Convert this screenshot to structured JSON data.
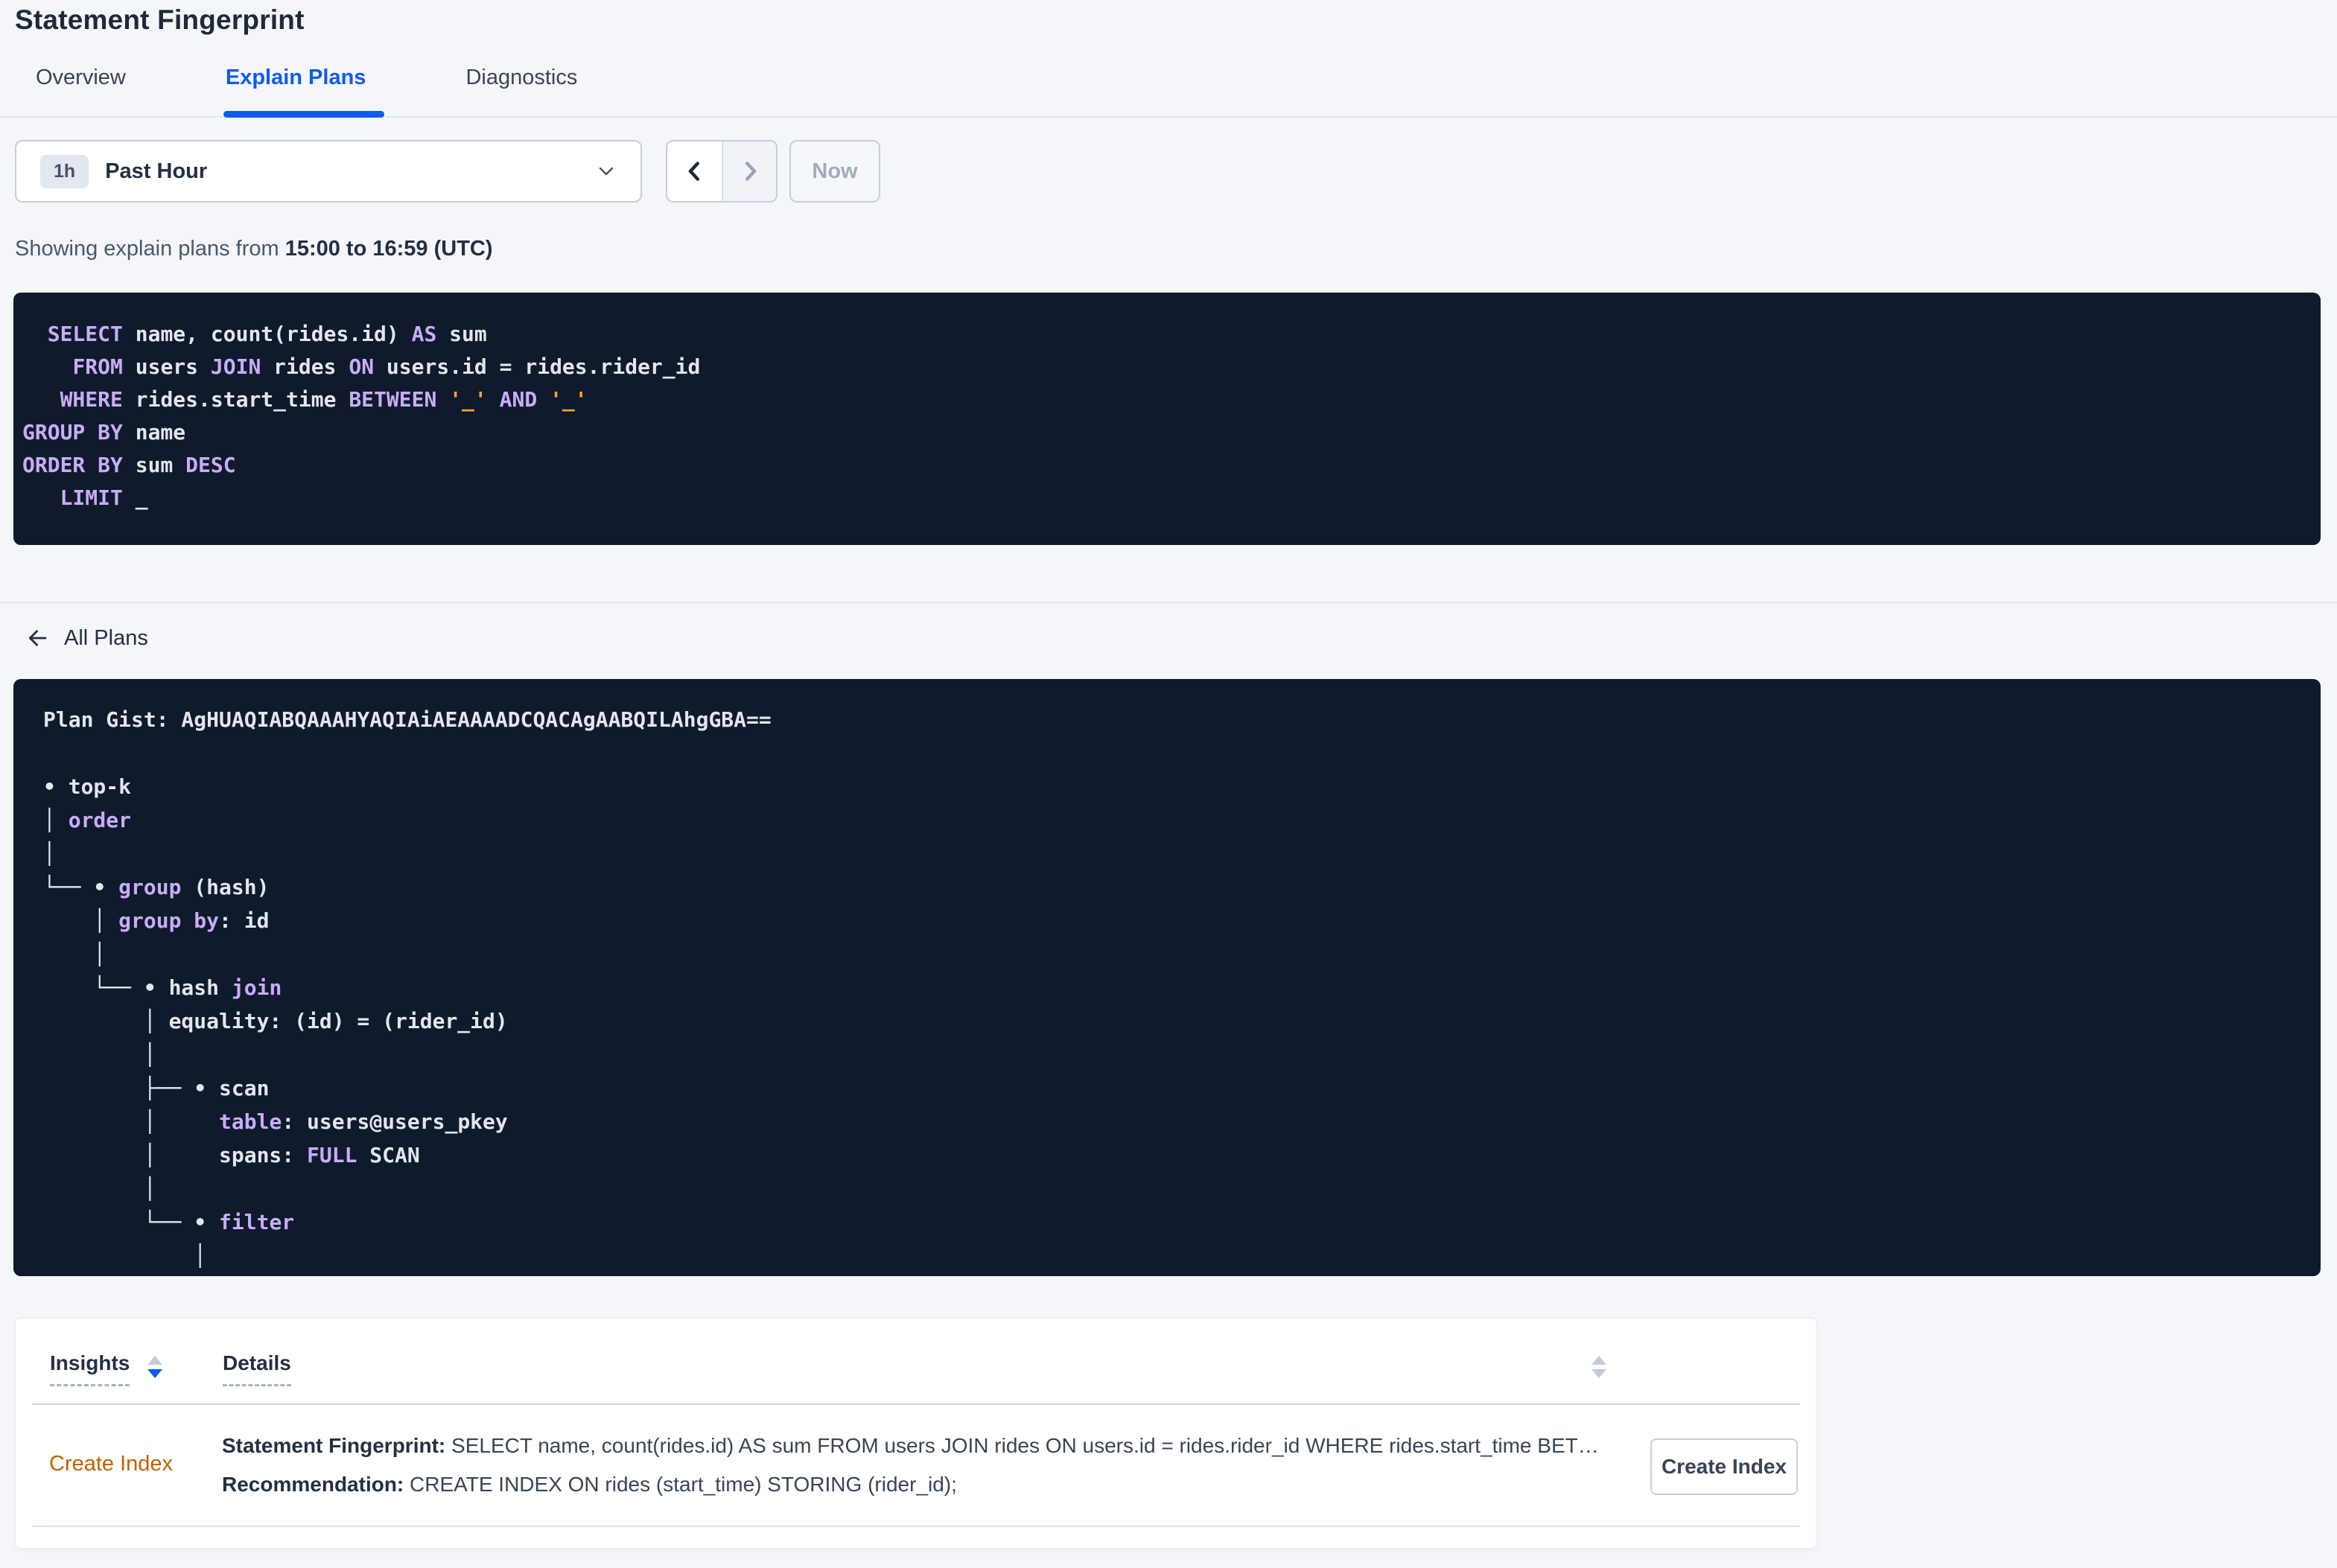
{
  "colors": {
    "accent_blue": "#0f5bf0",
    "code_background": "#0f1a2c",
    "code_keyword_purple": "#c9adf5",
    "code_plain": "#e2e6f0",
    "code_literal_orange": "#f6a82c",
    "insight_link_orange": "#bf6104",
    "page_background": "#f5f6fa"
  },
  "header": {
    "title": "Statement Fingerprint"
  },
  "tabs": {
    "items": [
      {
        "label": "Overview",
        "active": false
      },
      {
        "label": "Explain Plans",
        "active": true
      },
      {
        "label": "Diagnostics",
        "active": false
      }
    ]
  },
  "time_controls": {
    "range_badge": "1h",
    "range_label": "Past Hour",
    "now_label": "Now"
  },
  "status": {
    "prefix": "Showing explain plans from ",
    "range_bold": "15:00 to 16:59 (UTC)"
  },
  "sql_block": {
    "lines": [
      [
        [
          "p",
          "  "
        ],
        [
          "k",
          "SELECT"
        ],
        [
          "p",
          " name, count(rides.id) "
        ],
        [
          "k",
          "AS"
        ],
        [
          "p",
          " sum"
        ]
      ],
      [
        [
          "p",
          "    "
        ],
        [
          "k",
          "FROM"
        ],
        [
          "p",
          " users "
        ],
        [
          "k",
          "JOIN"
        ],
        [
          "p",
          " rides "
        ],
        [
          "k",
          "ON"
        ],
        [
          "p",
          " users.id = rides.rider_id"
        ]
      ],
      [
        [
          "p",
          "   "
        ],
        [
          "k",
          "WHERE"
        ],
        [
          "p",
          " rides.start_time "
        ],
        [
          "k",
          "BETWEEN"
        ],
        [
          "p",
          " "
        ],
        [
          "o",
          "'_'"
        ],
        [
          "p",
          " "
        ],
        [
          "k",
          "AND"
        ],
        [
          "p",
          " "
        ],
        [
          "o",
          "'_'"
        ]
      ],
      [
        [
          "k",
          "GROUP BY"
        ],
        [
          "p",
          " name"
        ]
      ],
      [
        [
          "k",
          "ORDER BY"
        ],
        [
          "p",
          " sum "
        ],
        [
          "k",
          "DESC"
        ]
      ],
      [
        [
          "p",
          "   "
        ],
        [
          "k",
          "LIMIT"
        ],
        [
          "p",
          " _"
        ]
      ]
    ]
  },
  "nav": {
    "all_plans_label": "All Plans"
  },
  "plan_block": {
    "gist": "AgHUAQIABQAAAHYAQIAiAEAAAADCQACAgAABQILAhgGBA==",
    "lines": [
      [
        [
          "p",
          "Plan Gist: AgHUAQIABQAAAHYAQIAiAEAAAADCQACAgAABQILAhgGBA=="
        ]
      ],
      [
        [
          "p",
          ""
        ]
      ],
      [
        [
          "p",
          "• top-k"
        ]
      ],
      [
        [
          "p",
          "│ "
        ],
        [
          "k",
          "order"
        ]
      ],
      [
        [
          "p",
          "│"
        ]
      ],
      [
        [
          "p",
          "└── • "
        ],
        [
          "k",
          "group"
        ],
        [
          "p",
          " (hash)"
        ]
      ],
      [
        [
          "p",
          "    │ "
        ],
        [
          "k",
          "group by"
        ],
        [
          "p",
          ": id"
        ]
      ],
      [
        [
          "p",
          "    │"
        ]
      ],
      [
        [
          "p",
          "    └── • hash "
        ],
        [
          "k",
          "join"
        ]
      ],
      [
        [
          "p",
          "        │ equality: (id) = (rider_id)"
        ]
      ],
      [
        [
          "p",
          "        │"
        ]
      ],
      [
        [
          "p",
          "        ├── • scan"
        ]
      ],
      [
        [
          "p",
          "        │     "
        ],
        [
          "k",
          "table"
        ],
        [
          "p",
          ": users@users_pkey"
        ]
      ],
      [
        [
          "p",
          "        │     spans: "
        ],
        [
          "k",
          "FULL"
        ],
        [
          "p",
          " SCAN"
        ]
      ],
      [
        [
          "p",
          "        │"
        ]
      ],
      [
        [
          "p",
          "        └── • "
        ],
        [
          "k",
          "filter"
        ]
      ],
      [
        [
          "p",
          "            │"
        ]
      ]
    ]
  },
  "insights_table": {
    "columns": [
      "Insights",
      "Details"
    ],
    "row": {
      "insight_link": "Create Index",
      "fingerprint_label": "Statement Fingerprint:",
      "fingerprint_value": " SELECT name, count(rides.id) AS sum FROM users JOIN rides ON users.id = rides.rider_id WHERE rides.start_time BETWEEN '_…",
      "recommendation_label": "Recommendation:",
      "recommendation_value": " CREATE INDEX ON rides (start_time) STORING (rider_id);",
      "action_button": "Create Index"
    }
  }
}
